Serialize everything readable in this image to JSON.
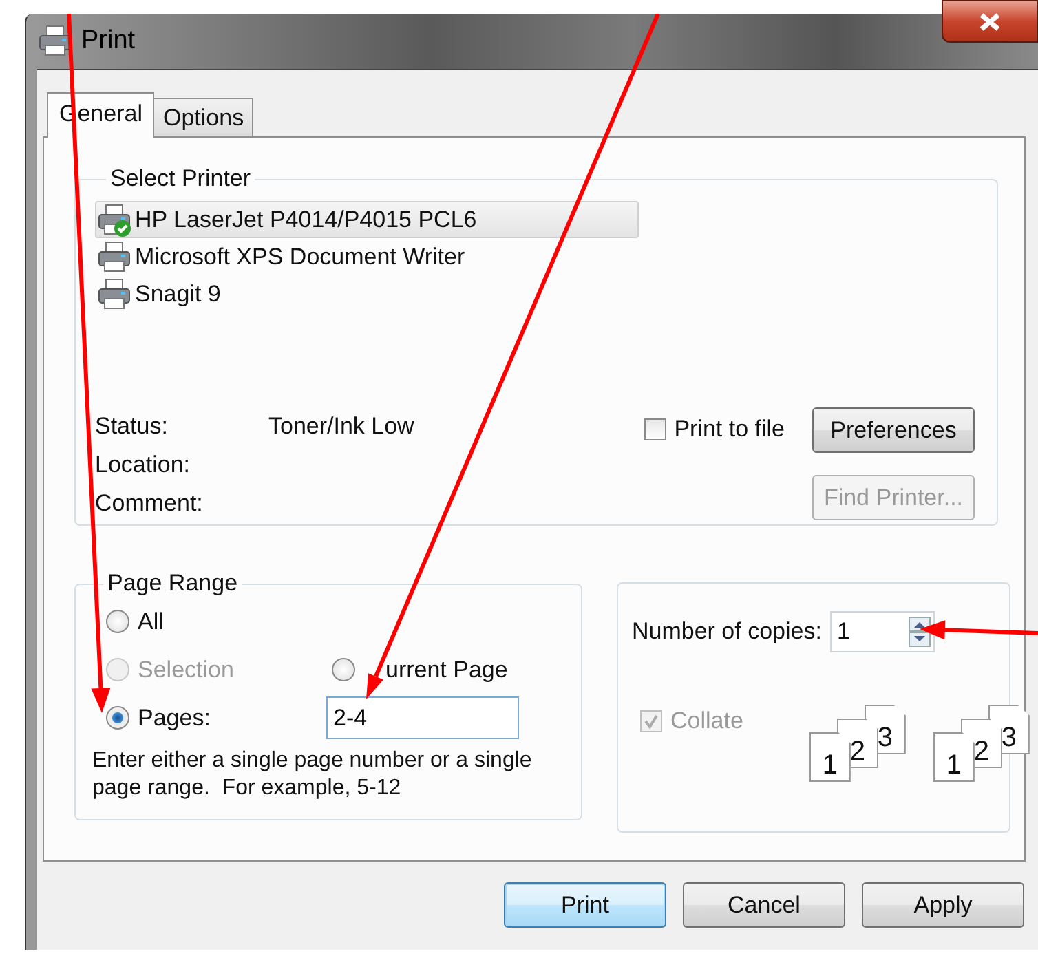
{
  "window": {
    "title": "Print"
  },
  "tabs": [
    {
      "label": "General",
      "selected": true
    },
    {
      "label": "Options",
      "selected": false
    }
  ],
  "select_printer": {
    "title": "Select Printer",
    "printers": [
      {
        "name": "HP LaserJet P4014/P4015 PCL6",
        "selected": true,
        "default": true
      },
      {
        "name": "Microsoft XPS Document Writer",
        "selected": false,
        "default": false
      },
      {
        "name": "Snagit 9",
        "selected": false,
        "default": false
      }
    ],
    "status_label": "Status:",
    "status": "Toner/Ink Low",
    "location_label": "Location:",
    "comment_label": "Comment:",
    "print_to_file": {
      "label": "Print to file",
      "checked": false
    },
    "preferences": {
      "label": "Preferences",
      "disabled": false
    },
    "find_printer": {
      "label": "Find Printer...",
      "disabled": true
    }
  },
  "page_range": {
    "title": "Page Range",
    "options": [
      {
        "label": "All",
        "selected": false,
        "disabled": false
      },
      {
        "label": "Selection",
        "selected": false,
        "disabled": true
      },
      {
        "label": "urrent Page",
        "selected": false,
        "disabled": false
      },
      {
        "label": "Pages:",
        "selected": true,
        "disabled": false
      }
    ],
    "pages_value": "2-4",
    "hint": "Enter either a single page number or a single page range.  For example, 5-12"
  },
  "copies": {
    "label": "Number of copies:",
    "value": "1",
    "collate": {
      "label": "Collate",
      "checked": true,
      "disabled": true
    },
    "stacks": [
      [
        "1",
        "2",
        "3"
      ],
      [
        "1",
        "2",
        "3"
      ]
    ]
  },
  "buttons": [
    {
      "label": "Print",
      "default": true
    },
    {
      "label": "Cancel",
      "default": false
    },
    {
      "label": "Apply",
      "default": false
    }
  ]
}
